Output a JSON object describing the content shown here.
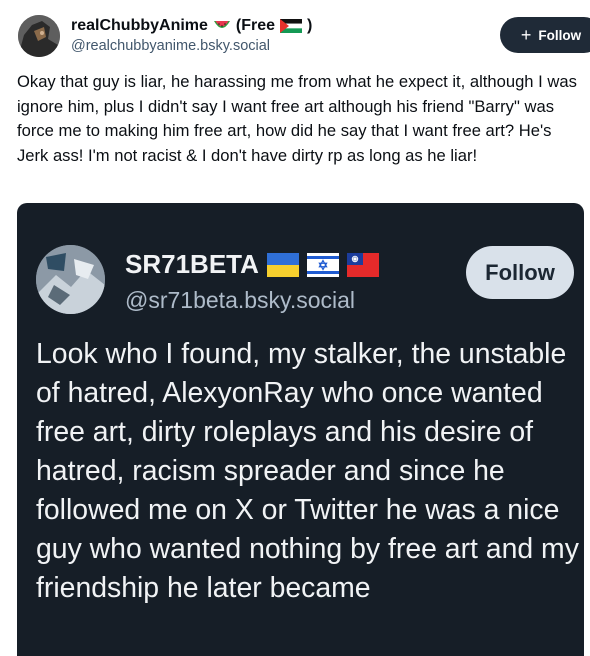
{
  "post": {
    "display_name": "realChubbyAnime",
    "name_suffix": "(Free",
    "name_close": ")",
    "handle": "@realchubbyanime.bsky.social",
    "follow_label": "Follow",
    "text": "Okay that guy is liar, he harassing me from what he expect it, although I was ignore him, plus I didn't say I want free art although his friend \"Barry\" was force me to making him free art, how did he say that I want free art? He's Jerk ass! I'm not racist & I don't have dirty rp as long as he liar!"
  },
  "embed": {
    "display_name": "SR71BETA",
    "handle": "@sr71beta.bsky.social",
    "follow_label": "Follow",
    "text": "Look who I found, my stalker, the unstable of hatred, AlexyonRay who once wanted free art, dirty roleplays and his desire of hatred, racism spreader and since he followed me on X or Twitter he was a nice guy who wanted nothing by free art and my friendship he later became"
  },
  "icons": {
    "follow_plus": "plus-icon",
    "name_emoji": "watermelon-icon",
    "name_flag": "palestine-flag-icon",
    "embed_flags": [
      "ukraine-flag-icon",
      "israel-flag-icon",
      "taiwan-flag-icon"
    ]
  },
  "colors": {
    "follow_button": "#1f2a37",
    "embed_background": "#161e27",
    "embed_follow_button": "#d9e1ea",
    "handle_text": "#42576c"
  }
}
